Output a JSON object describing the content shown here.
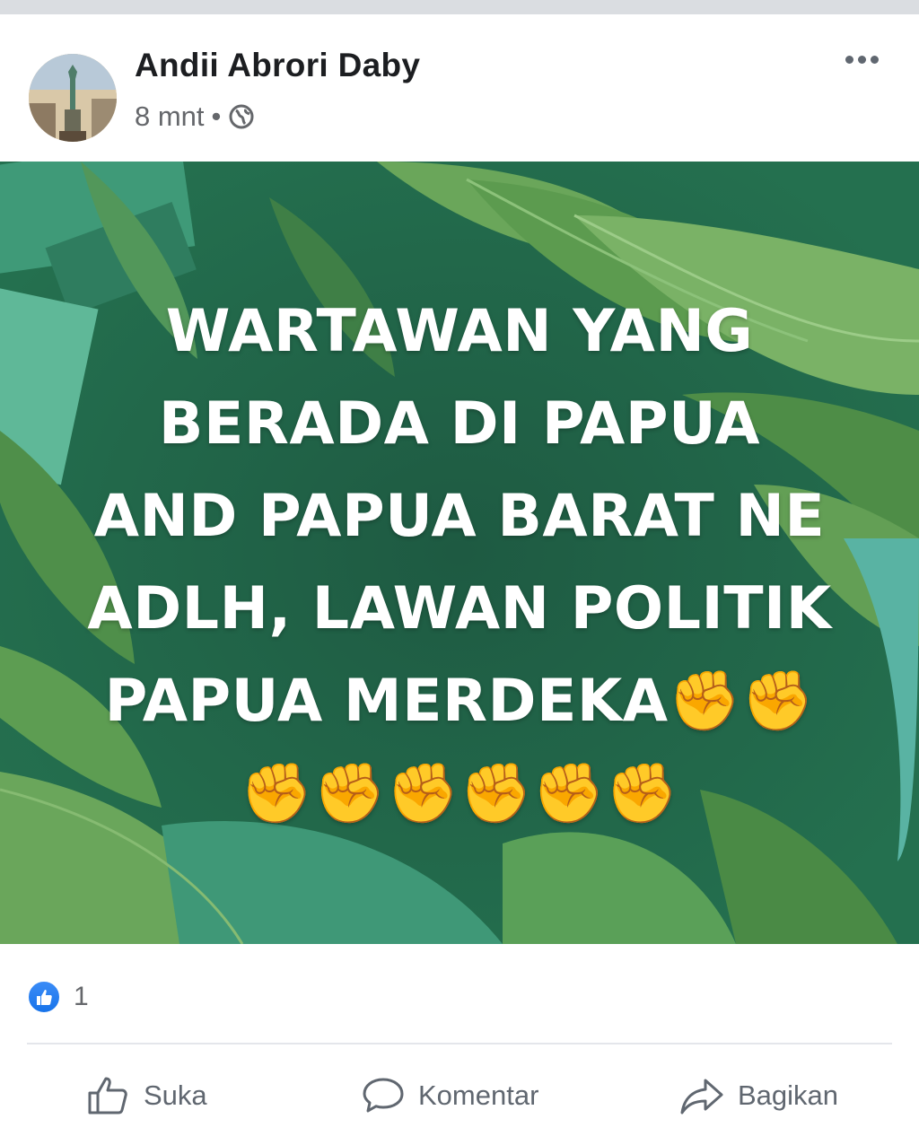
{
  "post": {
    "author": "Andii Abrori Daby",
    "time": "8 mnt",
    "privacy_icon": "globe-icon",
    "more_icon": "more-horizontal-icon",
    "text_lines": [
      "WARTAWAN YANG",
      "BERADA DI PAPUA",
      "AND PAPUA BARAT NE",
      "ADLH, LAWAN POLITIK",
      "PAPUA MERDEKA✊✊",
      "✊✊✊✊✊✊"
    ],
    "background_color": "#1f5f45",
    "reactions": {
      "icon": "like-icon",
      "count": "1"
    }
  },
  "actions": {
    "like_label": "Suka",
    "comment_label": "Komentar",
    "share_label": "Bagikan"
  },
  "colors": {
    "accent": "#1877f2",
    "text_primary": "#1c1e21",
    "text_secondary": "#65676b"
  }
}
